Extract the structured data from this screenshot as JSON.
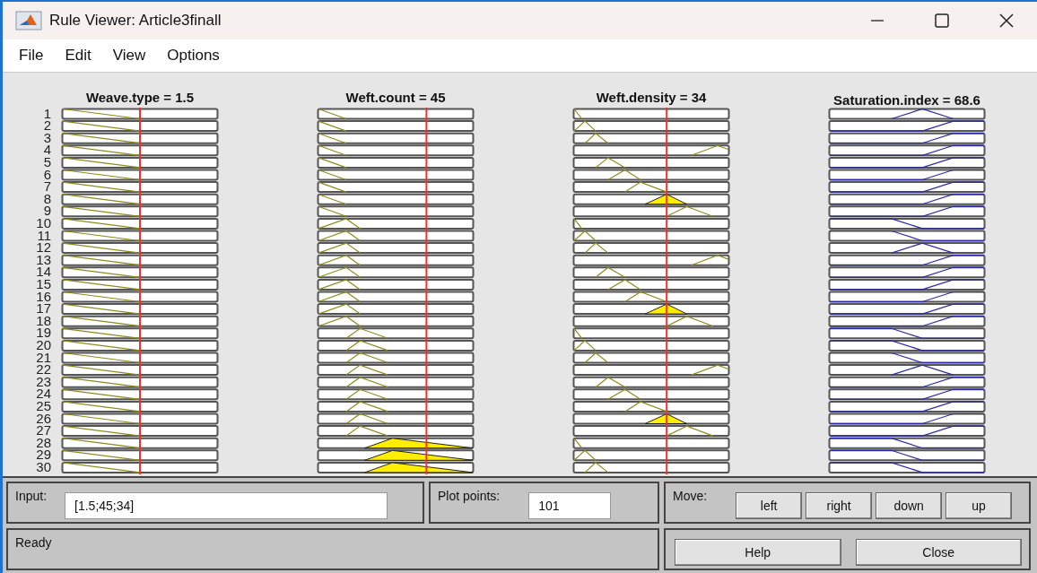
{
  "window": {
    "title": "Rule Viewer: Article3finall"
  },
  "menu": [
    "File",
    "Edit",
    "View",
    "Options"
  ],
  "variables": [
    {
      "title": "Weave.type = 1.5",
      "kind": "input"
    },
    {
      "title": "Weft.count = 45",
      "kind": "input"
    },
    {
      "title": "Weft.density = 34",
      "kind": "input"
    },
    {
      "title": "Saturation.index = 68.6",
      "kind": "output"
    }
  ],
  "rule_numbers": [
    "1",
    "2",
    "3",
    "4",
    "5",
    "6",
    "7",
    "8",
    "9",
    "10",
    "11",
    "12",
    "13",
    "14",
    "15",
    "16",
    "17",
    "18",
    "19",
    "20",
    "21",
    "22",
    "23",
    "24",
    "25",
    "26",
    "27",
    "28",
    "29",
    "30"
  ],
  "input": {
    "label": "Input:",
    "value": "[1.5;45;34]"
  },
  "plot_points": {
    "label": "Plot points:",
    "value": "101"
  },
  "move": {
    "label": "Move:",
    "buttons": [
      "left",
      "right",
      "down",
      "up"
    ]
  },
  "status": "Ready",
  "buttons": [
    "Help",
    "Close"
  ]
}
